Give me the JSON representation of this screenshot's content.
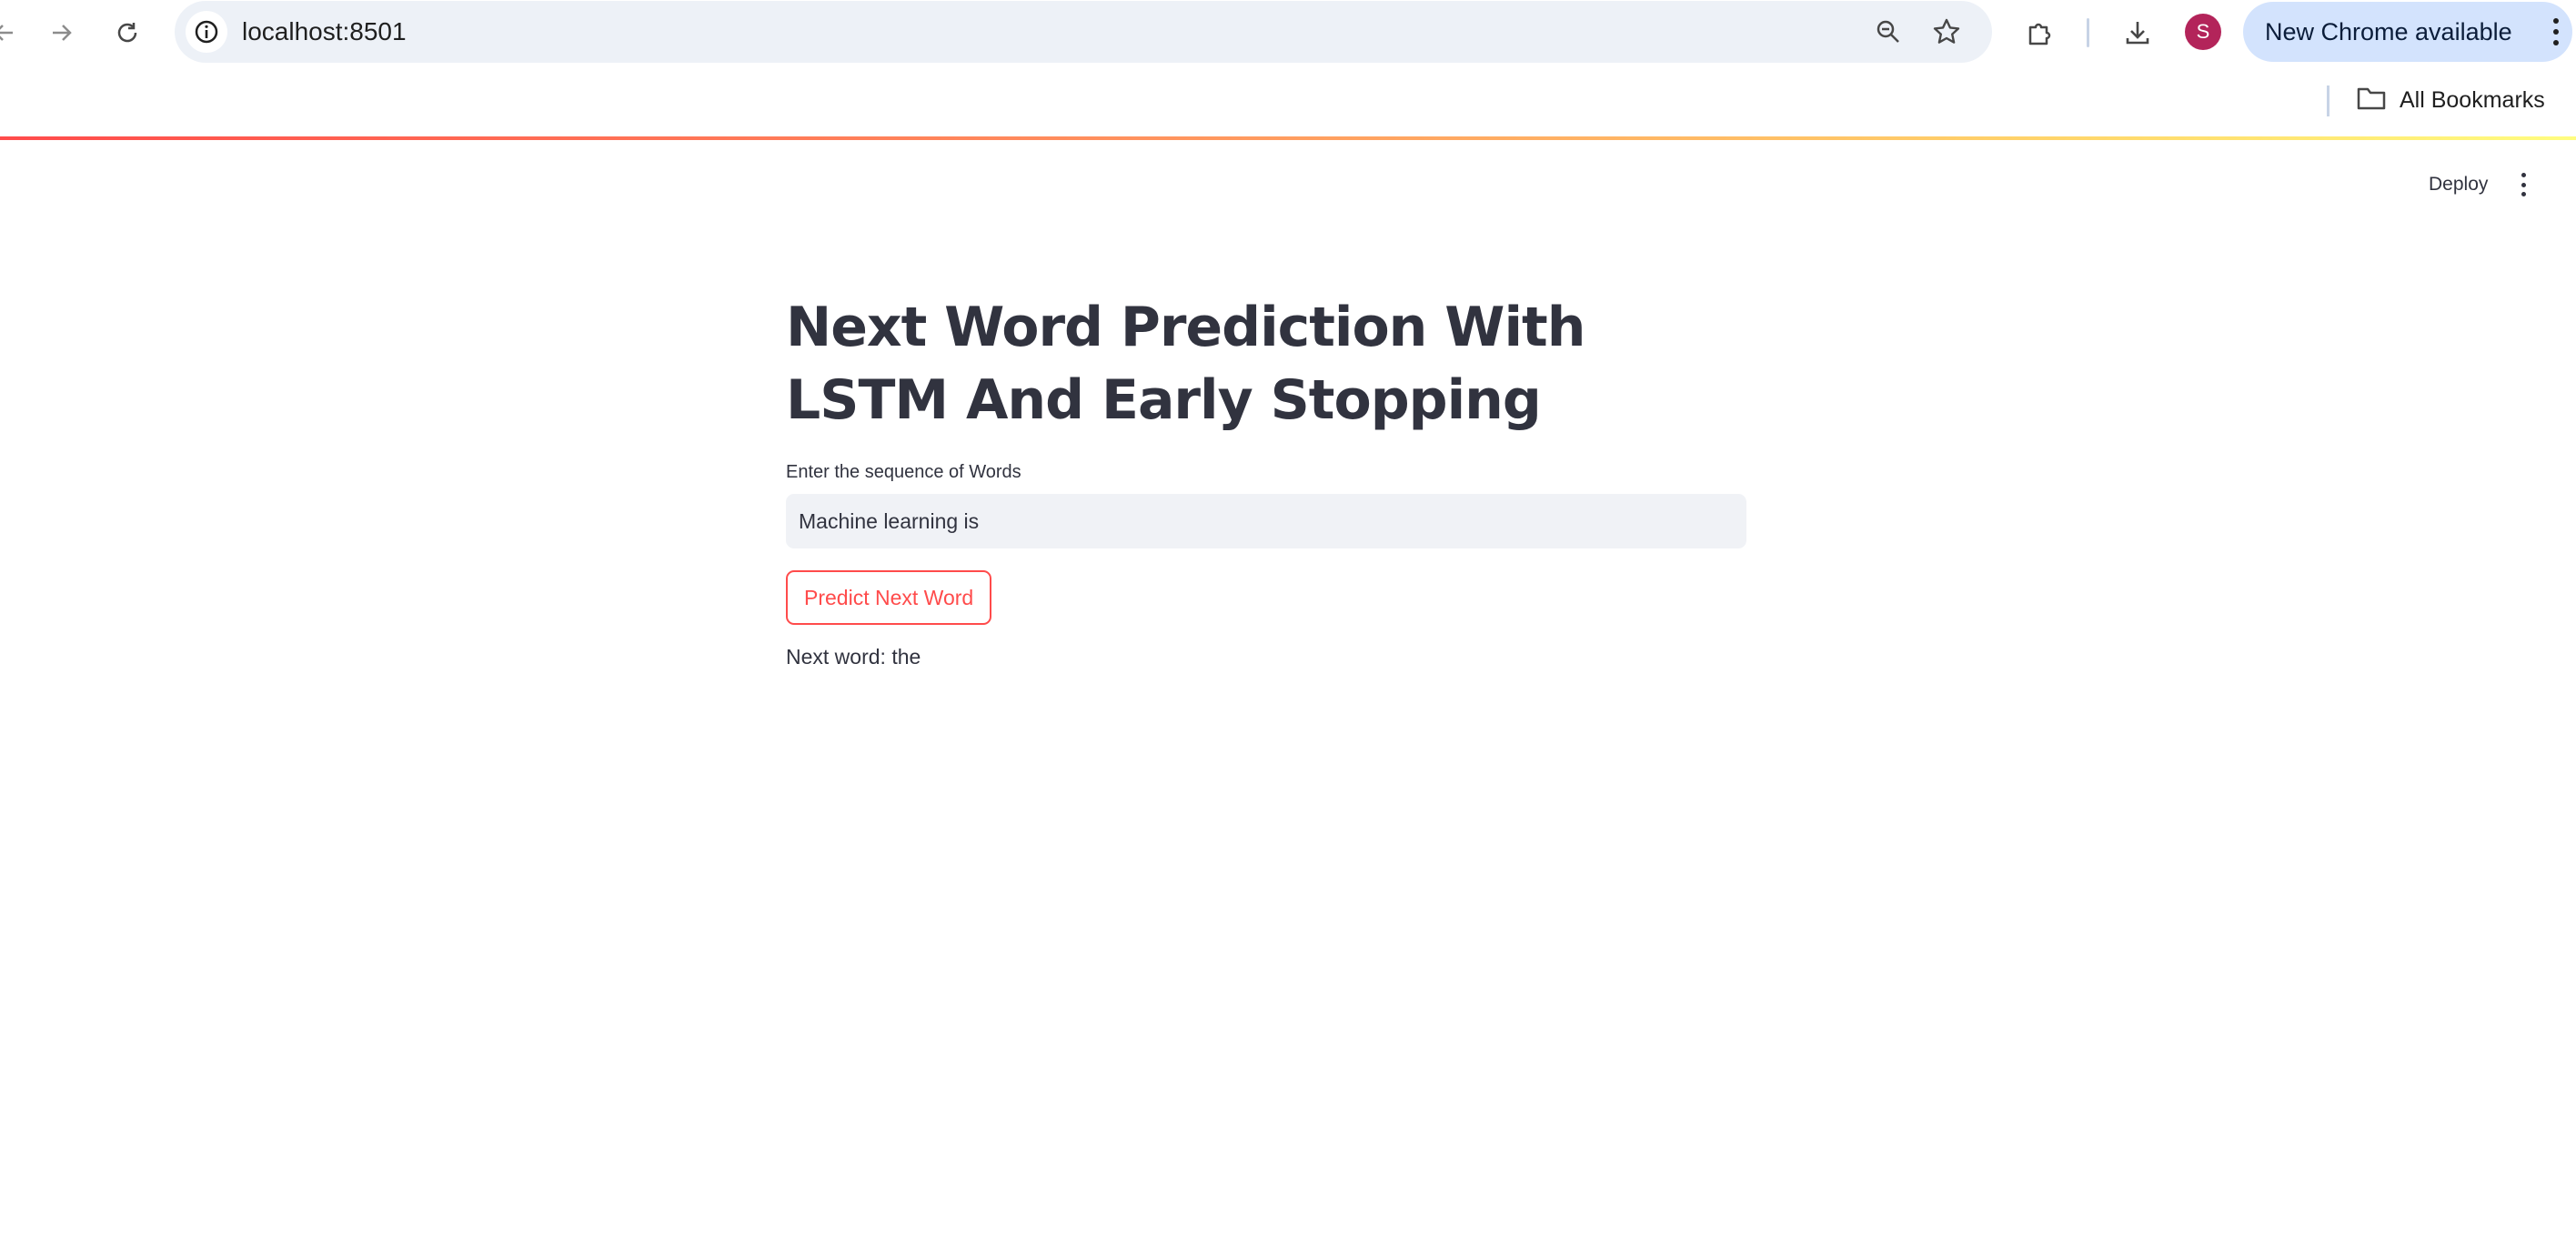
{
  "browser": {
    "url": "localhost:8501",
    "update_label": "New Chrome available",
    "profile_initial": "S",
    "bookmarks_label": "All Bookmarks",
    "icons": {
      "back": "back-arrow-icon",
      "forward": "forward-arrow-icon",
      "reload": "reload-icon",
      "site_info": "info-icon",
      "zoom": "zoom-icon",
      "bookmark": "star-icon",
      "extensions": "puzzle-icon",
      "downloads": "download-icon",
      "menu": "kebab-icon",
      "bookmarks_folder": "folder-icon"
    }
  },
  "app": {
    "deploy_label": "Deploy",
    "title": "Next Word Prediction With LSTM And Early Stopping",
    "input_label": "Enter the sequence of Words",
    "input_value": "Machine learning is",
    "button_label": "Predict Next Word",
    "result_text": "Next word: the"
  },
  "colors": {
    "accent": "#ff4b4b",
    "text": "#31333f",
    "input_bg": "#f0f2f6",
    "avatar": "#b3245a",
    "update_pill": "#d3e3fd"
  }
}
